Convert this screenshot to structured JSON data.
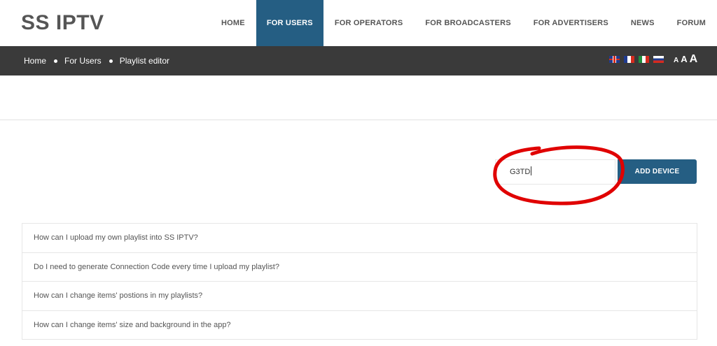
{
  "header": {
    "logo": "SS IPTV",
    "nav": [
      {
        "label": "HOME",
        "active": false
      },
      {
        "label": "FOR USERS",
        "active": true
      },
      {
        "label": "FOR OPERATORS",
        "active": false
      },
      {
        "label": "FOR BROADCASTERS",
        "active": false
      },
      {
        "label": "FOR ADVERTISERS",
        "active": false
      },
      {
        "label": "NEWS",
        "active": false
      },
      {
        "label": "FORUM",
        "active": false
      }
    ]
  },
  "breadcrumb": {
    "items": [
      "Home",
      "For Users",
      "Playlist editor"
    ]
  },
  "languages": [
    "uk-flag-icon",
    "fr-flag-icon",
    "it-flag-icon",
    "ru-flag-icon"
  ],
  "font_sizes": {
    "small": "A",
    "medium": "A",
    "large": "A"
  },
  "device": {
    "input_value": "G3TD",
    "button_label": "ADD DEVICE"
  },
  "faq": [
    "How can I upload my own playlist into SS IPTV?",
    "Do I need to generate Connection Code every time I upload my playlist?",
    "How can I change items' postions in my playlists?",
    "How can I change items' size and background in the app?"
  ],
  "colors": {
    "accent": "#255e83",
    "breadcrumb_bar": "#3a3a3a",
    "annotation": "#e00000"
  }
}
